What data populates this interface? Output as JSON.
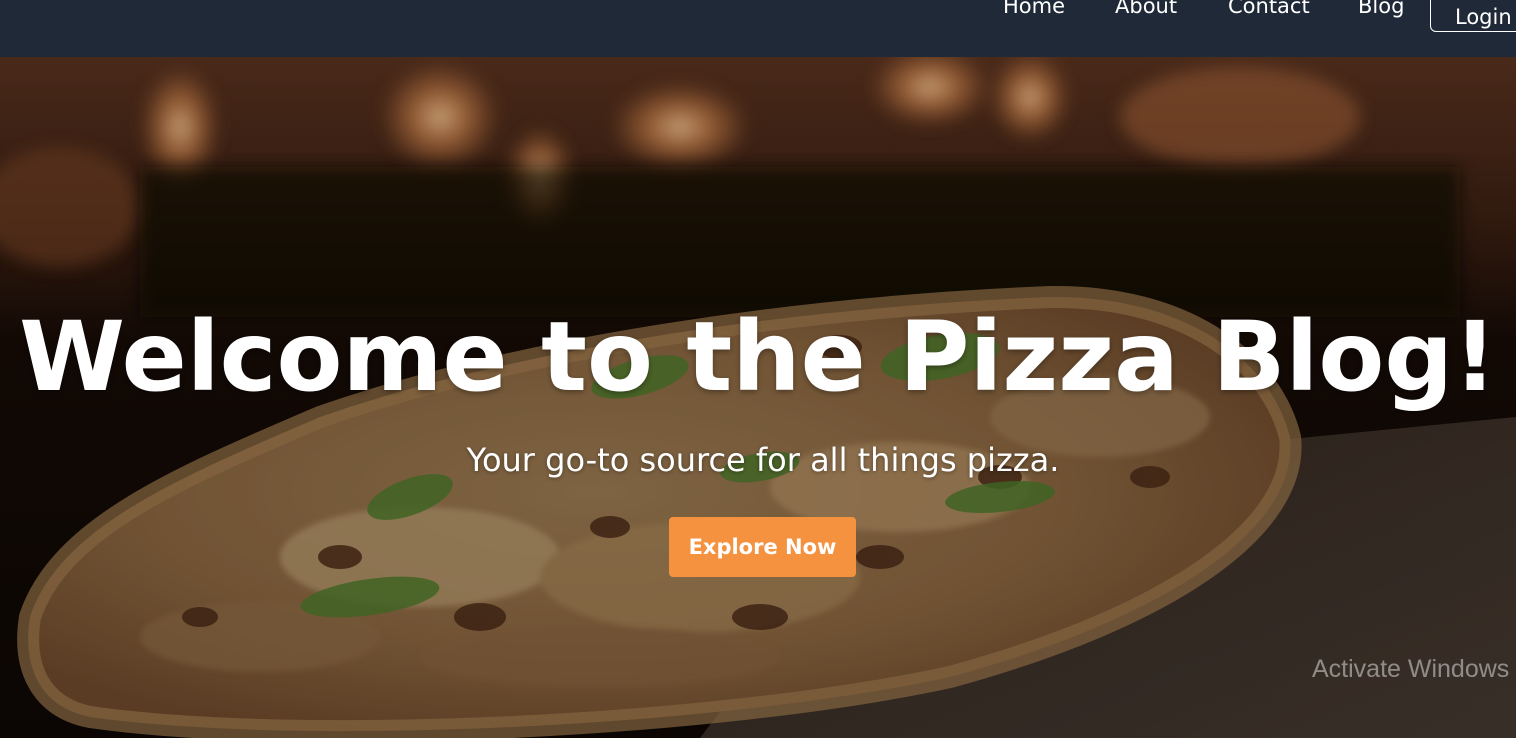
{
  "nav": {
    "items": [
      {
        "label": "Home"
      },
      {
        "label": "About"
      },
      {
        "label": "Contact"
      },
      {
        "label": "Blog"
      }
    ],
    "login_label": "Login"
  },
  "hero": {
    "title": "Welcome to the Pizza Blog!",
    "subtitle": "Your go-to source for all things pizza.",
    "cta_label": "Explore Now"
  },
  "watermark": {
    "text": "Activate Windows"
  },
  "colors": {
    "navbar_bg": "#1f2937",
    "cta_bg": "#f59240",
    "text": "#ffffff"
  }
}
